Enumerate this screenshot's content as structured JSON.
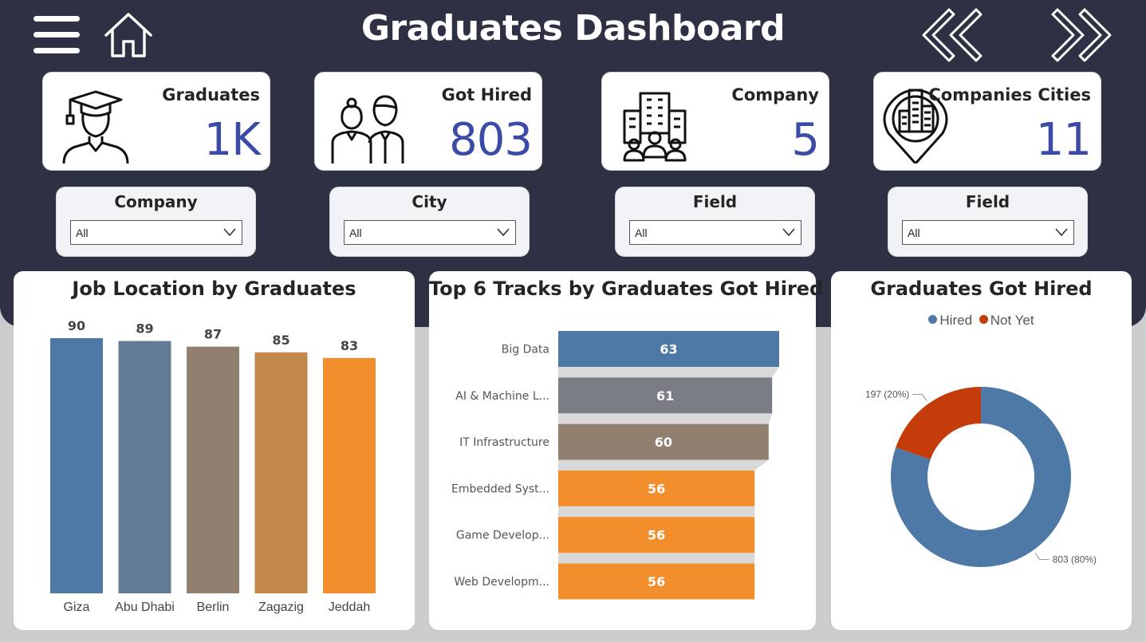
{
  "header": {
    "title": "Graduates Dashboard",
    "menu_icon": "hamburger-menu-icon",
    "home_icon": "home-icon",
    "back_icon": "double-chevron-left-icon",
    "forward_icon": "double-chevron-right-icon"
  },
  "kpis": [
    {
      "label": "Graduates",
      "value": "1K",
      "icon": "graduate-icon"
    },
    {
      "label": "Got Hired",
      "value": "803",
      "icon": "employees-icon"
    },
    {
      "label": "Company",
      "value": "5",
      "icon": "company-building-icon"
    },
    {
      "label": "Companies Cities",
      "value": "11",
      "icon": "city-location-pin-icon"
    }
  ],
  "slicers": [
    {
      "title": "Company",
      "value": "All"
    },
    {
      "title": "City",
      "value": "All"
    },
    {
      "title": "Field",
      "value": "All"
    },
    {
      "title": "Field",
      "value": "All"
    }
  ],
  "colors": {
    "header_bg": "#2e3143",
    "kpi_value": "#3d4ba8",
    "blue": "#4e79a7",
    "slate": "#637b94",
    "taupe": "#917f70",
    "brown": "#c2874b",
    "orange": "#f28e2b",
    "gray": "#7a7d84",
    "red": "#c43c0a"
  },
  "chart_data": [
    {
      "type": "bar",
      "title": "Job Location by Graduates",
      "categories": [
        "Giza",
        "Abu Dhabi",
        "Berlin",
        "Zagazig",
        "Jeddah"
      ],
      "values": [
        90,
        89,
        87,
        85,
        83
      ],
      "colors": [
        "#4e79a7",
        "#637b94",
        "#917f70",
        "#c2874b",
        "#f28e2b"
      ],
      "ylim": [
        0,
        90
      ],
      "grid": false
    },
    {
      "type": "bar",
      "orientation": "horizontal",
      "title": "Top 6 Tracks by Graduates Got Hired",
      "categories": [
        "Big Data",
        "AI & Machine L...",
        "IT Infrastructure",
        "Embedded Syst...",
        "Game Develop...",
        "Web Developm..."
      ],
      "values": [
        63,
        61,
        60,
        56,
        56,
        56
      ],
      "colors": [
        "#4e79a7",
        "#7a7d84",
        "#917f70",
        "#f28e2b",
        "#f28e2b",
        "#f28e2b"
      ],
      "xlim": [
        0,
        63
      ],
      "grid": false
    },
    {
      "type": "pie",
      "title": "Graduates Got Hired",
      "labels": [
        "Hired",
        "Not Yet"
      ],
      "values": [
        803,
        197
      ],
      "data_labels": [
        "803 (80%)",
        "197 (20%)"
      ],
      "colors": [
        "#4e79a7",
        "#c43c0a"
      ],
      "legend_position": "top"
    }
  ]
}
